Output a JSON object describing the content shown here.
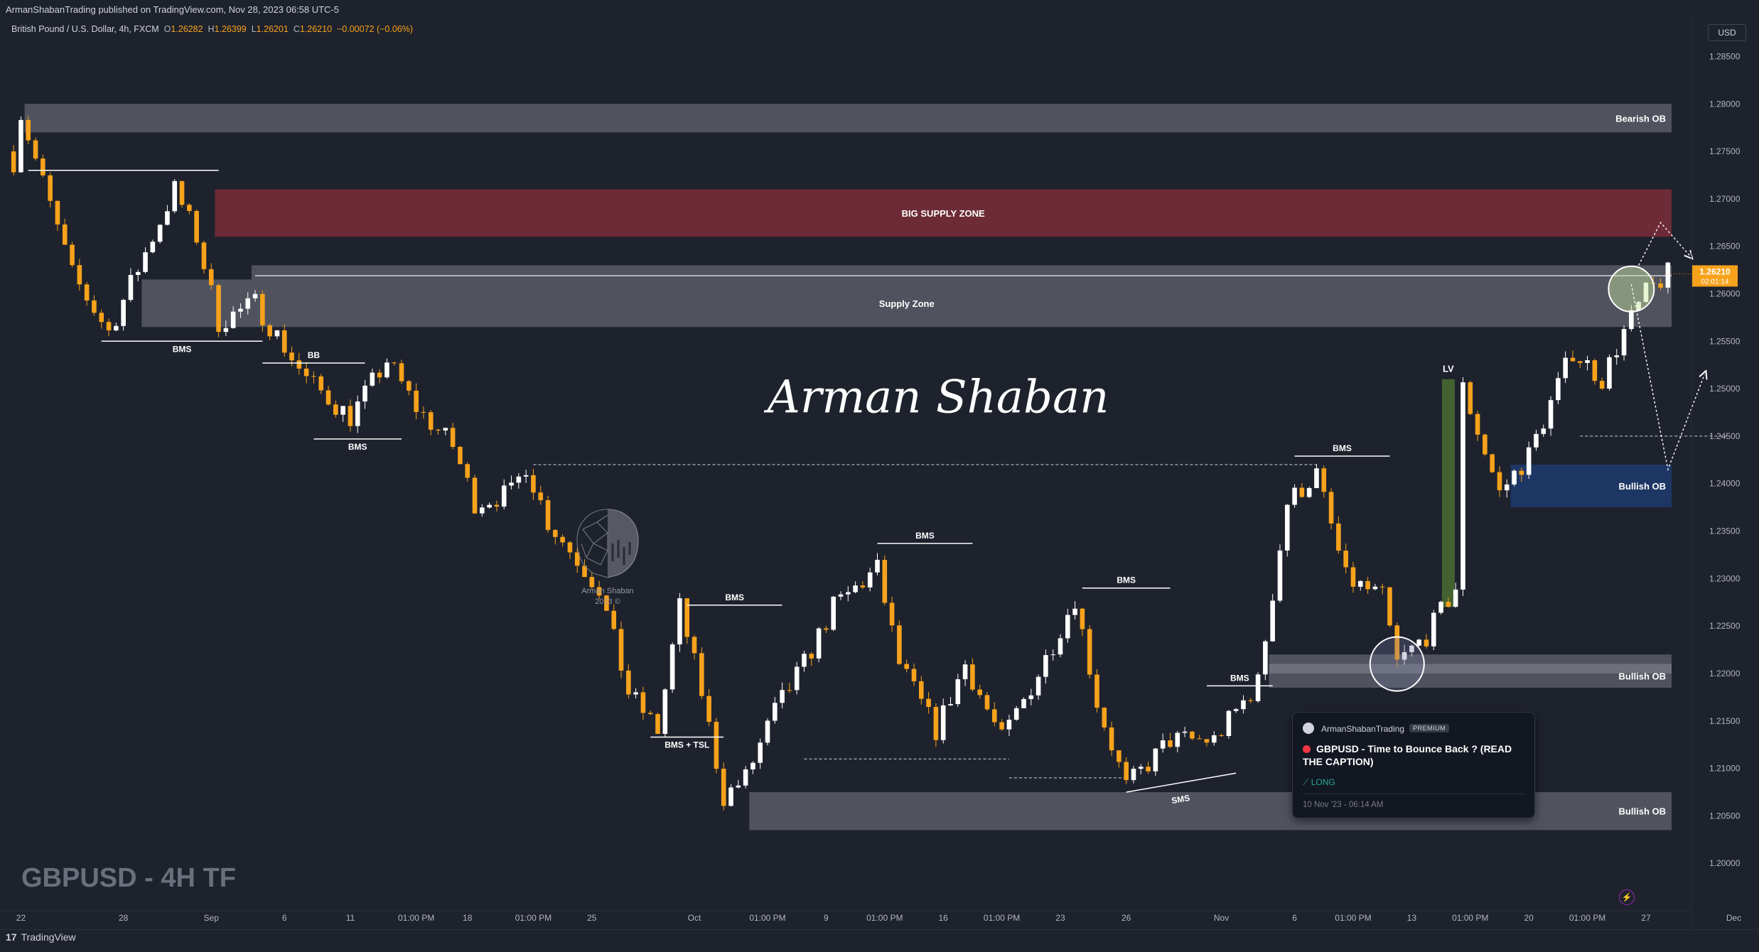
{
  "header": {
    "published": "ArmanShabanTrading published on TradingView.com, Nov 28, 2023 06:58 UTC-5",
    "symbol": "British Pound / U.S. Dollar, 4h, FXCM",
    "o_label": "O",
    "o_val": "1.26282",
    "h_label": "H",
    "h_val": "1.26399",
    "l_label": "L",
    "l_val": "1.26201",
    "c_label": "C",
    "c_val": "1.26210",
    "change": "−0.00072 (−0.06%)"
  },
  "currency": "USD",
  "watermark_title": "GBPUSD - 4H TF",
  "signature": "Arman Shaban",
  "logo_text": {
    "line1": "Arman Shaban",
    "line2": "2023 ©"
  },
  "footer": {
    "brand_mark": "17",
    "brand": "TradingView"
  },
  "price_label": {
    "value": "1.26210",
    "countdown": "02:01:14"
  },
  "idea_card": {
    "author": "ArmanShabanTrading",
    "badge": "PREMIUM",
    "title": "GBPUSD - Time to Bounce Back ? (READ THE CAPTION)",
    "direction": "LONG",
    "date": "10 Nov '23 - 06:14 AM"
  },
  "colors": {
    "background": "#1e222d",
    "up_candle": "#ffffff",
    "down_candle": "#f7a21b",
    "supply_zone": "#9598a1",
    "big_supply": "#7b2d3a",
    "bullish_ob_blue": "#1e3a6e",
    "lv_green": "#3d5a2a"
  },
  "chart_data": {
    "type": "candlestick",
    "symbol": "GBPUSD",
    "timeframe": "4h",
    "ylim": [
      1.195,
      1.289
    ],
    "y_ticks": [
      1.2,
      1.205,
      1.21,
      1.215,
      1.22,
      1.225,
      1.23,
      1.235,
      1.24,
      1.245,
      1.25,
      1.255,
      1.26,
      1.265,
      1.27,
      1.275,
      1.28,
      1.285
    ],
    "y_tick_labels": [
      "1.20000",
      "1.20500",
      "1.21000",
      "1.21500",
      "1.22000",
      "1.22500",
      "1.23000",
      "1.23500",
      "1.24000",
      "1.24500",
      "1.25000",
      "1.25500",
      "1.26000",
      "1.26500",
      "1.27000",
      "1.27500",
      "1.28000",
      "1.28500"
    ],
    "x_ticks": [
      {
        "label": "22",
        "i": 1
      },
      {
        "label": "28",
        "i": 15
      },
      {
        "label": "Sep",
        "i": 27
      },
      {
        "label": "6",
        "i": 37
      },
      {
        "label": "11",
        "i": 46
      },
      {
        "label": "01:00 PM",
        "i": 55
      },
      {
        "label": "18",
        "i": 62
      },
      {
        "label": "01:00 PM",
        "i": 71
      },
      {
        "label": "25",
        "i": 79
      },
      {
        "label": "Oct",
        "i": 93
      },
      {
        "label": "01:00 PM",
        "i": 103
      },
      {
        "label": "9",
        "i": 111
      },
      {
        "label": "01:00 PM",
        "i": 119
      },
      {
        "label": "16",
        "i": 127
      },
      {
        "label": "01:00 PM",
        "i": 135
      },
      {
        "label": "23",
        "i": 143
      },
      {
        "label": "26",
        "i": 152
      },
      {
        "label": "Nov",
        "i": 165
      },
      {
        "label": "6",
        "i": 175
      },
      {
        "label": "01:00 PM",
        "i": 183
      },
      {
        "label": "13",
        "i": 191
      },
      {
        "label": "01:00 PM",
        "i": 199
      },
      {
        "label": "20",
        "i": 207
      },
      {
        "label": "01:00 PM",
        "i": 215
      },
      {
        "label": "27",
        "i": 223
      },
      {
        "label": "Dec",
        "i": 235
      }
    ],
    "candle_count": 227,
    "path": [
      [
        0,
        1.274
      ],
      [
        1,
        1.279
      ],
      [
        8,
        1.262
      ],
      [
        13,
        1.256
      ],
      [
        16,
        1.261
      ],
      [
        22,
        1.271
      ],
      [
        25,
        1.266
      ],
      [
        28,
        1.257
      ],
      [
        33,
        1.259
      ],
      [
        40,
        1.251
      ],
      [
        46,
        1.247
      ],
      [
        51,
        1.253
      ],
      [
        55,
        1.248
      ],
      [
        60,
        1.244
      ],
      [
        63,
        1.238
      ],
      [
        68,
        1.239
      ],
      [
        70,
        1.242
      ],
      [
        73,
        1.236
      ],
      [
        80,
        1.229
      ],
      [
        84,
        1.218
      ],
      [
        88,
        1.214
      ],
      [
        91,
        1.227
      ],
      [
        94,
        1.218
      ],
      [
        97,
        1.207
      ],
      [
        100,
        1.209
      ],
      [
        104,
        1.216
      ],
      [
        108,
        1.221
      ],
      [
        112,
        1.227
      ],
      [
        118,
        1.231
      ],
      [
        121,
        1.221
      ],
      [
        126,
        1.214
      ],
      [
        130,
        1.221
      ],
      [
        135,
        1.213
      ],
      [
        140,
        1.22
      ],
      [
        145,
        1.228
      ],
      [
        148,
        1.217
      ],
      [
        152,
        1.208
      ],
      [
        158,
        1.213
      ],
      [
        164,
        1.213
      ],
      [
        170,
        1.219
      ],
      [
        174,
        1.238
      ],
      [
        178,
        1.241
      ],
      [
        182,
        1.23
      ],
      [
        187,
        1.228
      ],
      [
        189,
        1.221
      ],
      [
        193,
        1.224
      ],
      [
        197,
        1.229
      ],
      [
        198,
        1.25
      ],
      [
        203,
        1.239
      ],
      [
        207,
        1.243
      ],
      [
        213,
        1.254
      ],
      [
        217,
        1.251
      ],
      [
        220,
        1.256
      ],
      [
        223,
        1.26
      ],
      [
        226,
        1.2621
      ]
    ],
    "last_close": 1.2621,
    "zones": [
      {
        "label": "Bearish OB",
        "x0": 2,
        "x1": 234,
        "y0": 1.277,
        "y1": 1.28,
        "color": "gray"
      },
      {
        "label": "BIG SUPPLY ZONE",
        "x0": 28,
        "x1": 234,
        "y0": 1.266,
        "y1": 1.271,
        "color": "red"
      },
      {
        "label": "Supply Zone",
        "x0": 18,
        "x1": 234,
        "y0": 1.2565,
        "y1": 1.2615,
        "color": "gray"
      },
      {
        "label": "",
        "x0": 33,
        "x1": 234,
        "y0": 1.2615,
        "y1": 1.263,
        "color": "gray"
      },
      {
        "label": "Bullish OB",
        "x0": 205,
        "x1": 234,
        "y0": 1.2375,
        "y1": 1.242,
        "color": "blue"
      },
      {
        "label": "",
        "x0": 172,
        "x1": 234,
        "y0": 1.22,
        "y1": 1.222,
        "color": "gray"
      },
      {
        "label": "Bullish OB",
        "x0": 172,
        "x1": 234,
        "y0": 1.2185,
        "y1": 1.221,
        "color": "gray"
      },
      {
        "label": "Bullish OB",
        "x0": 101,
        "x1": 234,
        "y0": 1.2035,
        "y1": 1.2075,
        "color": "gray"
      }
    ],
    "lv_bar": {
      "label": "LV",
      "x": 196,
      "y0": 1.227,
      "y1": 1.251
    },
    "annotations": [
      {
        "label": "BMS",
        "x0": 12,
        "x1": 34,
        "y": 1.255
      },
      {
        "label": "BB",
        "x0": 34,
        "x1": 48,
        "y": 1.2527
      },
      {
        "label": "BMS",
        "x0": 41,
        "x1": 53,
        "y": 1.2447
      },
      {
        "label": "BMS + TSL",
        "x0": 87,
        "x1": 97,
        "y": 1.2133
      },
      {
        "label": "BMS",
        "x0": 92,
        "x1": 105,
        "y": 1.2272
      },
      {
        "label": "BMS",
        "x0": 118,
        "x1": 131,
        "y": 1.2337
      },
      {
        "label": "BMS",
        "x0": 146,
        "x1": 158,
        "y": 1.229
      },
      {
        "label": "BMS",
        "x0": 163,
        "x1": 172,
        "y": 1.2187
      },
      {
        "label": "BMS",
        "x0": 175,
        "x1": 188,
        "y": 1.2429
      },
      {
        "label": "SMS",
        "x0": 152,
        "x1": 167,
        "y": 1.2075
      }
    ]
  }
}
